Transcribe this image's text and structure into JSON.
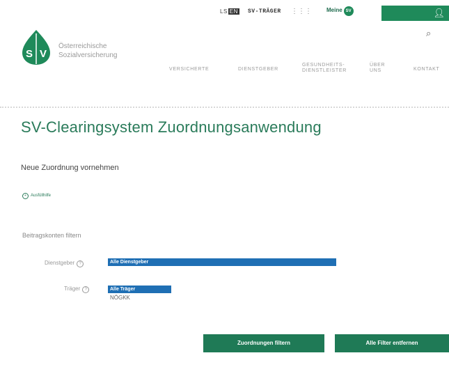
{
  "header": {
    "lang_label": "LS",
    "lang_box": "EN",
    "traeger_label": "SV-TRÄGER",
    "grid_icon": "grid-icon",
    "meine_label": "Meine",
    "meine_badge": "SV",
    "login_icon": "user-icon",
    "search_icon": "search-icon"
  },
  "logo": {
    "mark": "SV",
    "line1": "Österreichische",
    "line2": "Sozialversicherung"
  },
  "nav": {
    "items": [
      {
        "label": "VERSICHERTE"
      },
      {
        "label": "DIENSTGEBER"
      },
      {
        "label_line1": "GESUNDHEITS-",
        "label_line2": "DIENSTLEISTER"
      },
      {
        "label_line1": "ÜBER",
        "label_line2": "UNS"
      },
      {
        "label": "KONTAKT"
      }
    ]
  },
  "main": {
    "title": "SV-Clearingsystem Zuordnungsanwendung",
    "subtitle": "Neue Zuordnung vornehmen",
    "help_link": "Ausfüllhilfe",
    "filter_heading": "Beitragskonten filtern",
    "fields": {
      "dienstgeber_label": "Dienstgeber",
      "dienstgeber_selected": "Alle Dienstgeber",
      "traeger_label": "Träger",
      "traeger_selected": "Alle Träger",
      "traeger_option": "NÖGKK"
    },
    "buttons": {
      "filter": "Zuordnungen filtern",
      "reset": "Alle Filter entfernen"
    }
  },
  "colors": {
    "brand_green": "#1f8a5a",
    "title_green": "#2a7b5a",
    "select_blue": "#1f6fb4",
    "button_green": "#1f7a56"
  }
}
